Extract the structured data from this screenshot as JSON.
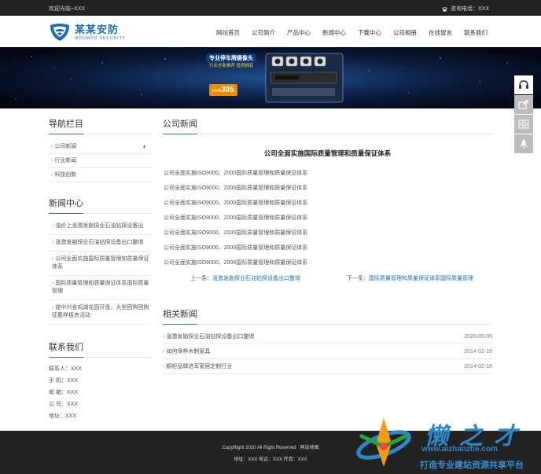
{
  "topbar": {
    "welcome": "欢迎光临~XXX",
    "hotline": "咨询电话：XXX"
  },
  "brand": {
    "name_cn": "某某安防",
    "name_en": "MOUMOU SECURITY",
    "color": "#1d6fb5"
  },
  "nav": [
    "网站首页",
    "公司简介",
    "产品中心",
    "新闻中心",
    "下载中心",
    "公司相册",
    "在线留言",
    "联系我们"
  ],
  "banner": {
    "promo_title": "专业停车牌摄像头",
    "promo_sub": "行业全新推荐 值得拥有",
    "price_prefix": "RMB",
    "price_value": "395"
  },
  "side_tools": [
    "headset-icon",
    "share-icon",
    "qrcode-icon",
    "rocket-icon"
  ],
  "sidebar": {
    "nav_title": "导航栏目",
    "categories": [
      "公司新闻",
      "行业新闻",
      "科技创新"
    ],
    "news_title": "新闻中心",
    "news": [
      "油价上涨激发勘探业石油钻探设备出",
      "涨激发勘探业石油钻探设备出口整增",
      "公司全面实施国际质量管理和质量保证体系",
      "国际质量管理和质量保证体系国际质量管理",
      "堤中兴金鸡湖花园开盘，大型团购团购征集样板房活动"
    ],
    "contact_title": "联系我们",
    "contacts": [
      "联系人：XXX",
      "手 机：XXX",
      "邮 箱：XXX",
      "公 司：XXX",
      "地址：XXX"
    ]
  },
  "main": {
    "section_title": "公司新闻",
    "article_title": "公司全面实施国际质量管理和质量保证体系",
    "paragraphs": [
      "公司全面实施ISO9000、2000国际质量管理和质量保证体系",
      "公司全面实施ISO9000、2000国际质量管理和质量保证体系",
      "公司全面实施ISO9000、2000国际质量管理和质量保证体系",
      "公司全面实施ISO9000、2000国际质量管理和质量保证体系",
      "公司全面实施ISO9000、2000国际质量管理和质量保证体系",
      "公司全面实施ISO9000、2000国际质量管理和质量保证体系",
      "公司全面实施ISO9000、2000国际质量管理和质量保证体系"
    ],
    "prev_label": "上一条：",
    "prev_link": "涨激发勘探业石油钻探设备出口整增",
    "next_label": "下一条：",
    "next_link": "国际质量管理和质量保证体系国际质量管理",
    "related_title": "相关新闻",
    "related": [
      {
        "title": "涨激发勘探业石油钻探设备出口整增",
        "date": "2020-05-06"
      },
      {
        "title": "如何保养木制家具",
        "date": "2014-02-16"
      },
      {
        "title": "橱柜品牌进军家居定制行业",
        "date": "2014-02-16"
      }
    ]
  },
  "footer": {
    "copyright": "CopyRight 2020 All Right Reserved",
    "sitemap": "网站地图",
    "address_line": "地址：XXX  电话：XXX  传真：XXX"
  },
  "watermark": {
    "name": "懒之才",
    "url": "www.aizhanzhe.com",
    "slogan": "打造专业建站资源共享平台"
  }
}
